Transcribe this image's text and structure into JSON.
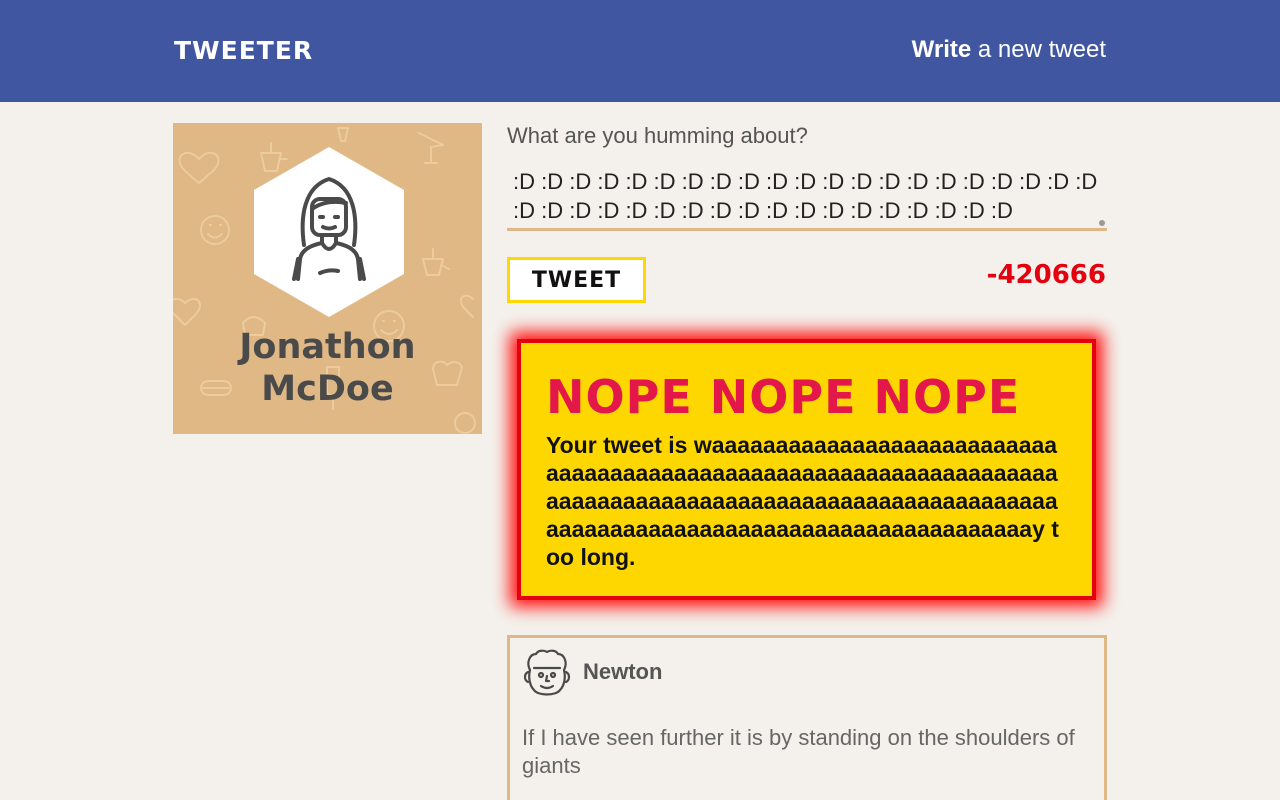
{
  "header": {
    "logo": "TWEETER",
    "compose_strong": "Write",
    "compose_rest": " a new tweet"
  },
  "profile": {
    "name": "Jonathon McDoe",
    "avatar_icon": "woman-avatar-icon",
    "background_color": "#dfb886"
  },
  "composer": {
    "prompt": "What are you humming about?",
    "value": ":D :D :D :D :D :D :D :D :D :D :D :D :D :D :D :D :D :D :D :D :D :D :D :D :D :D :D :D :D :D :D :D :D :D :D :D :D :D :D",
    "button_label": "TWEET",
    "counter": "-420666"
  },
  "error": {
    "title": "NOPE NOPE NOPE",
    "message": "Your tweet is waaaaaaaaaaaaaaaaaaaaaaaaaaaaaaaaaaaaaaaaaaaaaaaaaaaaaaaaaaaaaaaaaaaaaaaaaaaaaaaaaaaaaaaaaaaaaaaaaaaaaaaaaaaaaaaaaaaaaaaaaaaaaaaaaaaaaaaaaaaaaaaaay too long."
  },
  "tweets": [
    {
      "author": "Newton",
      "avatar_icon": "newton-avatar-icon",
      "text": "If I have seen further it is by standing on the shoulders of giants"
    }
  ],
  "colors": {
    "header": "#4056a1",
    "background": "#f4f1ec",
    "accent": "#dfb886",
    "warning": "#ffd700",
    "danger": "#e3000f"
  }
}
